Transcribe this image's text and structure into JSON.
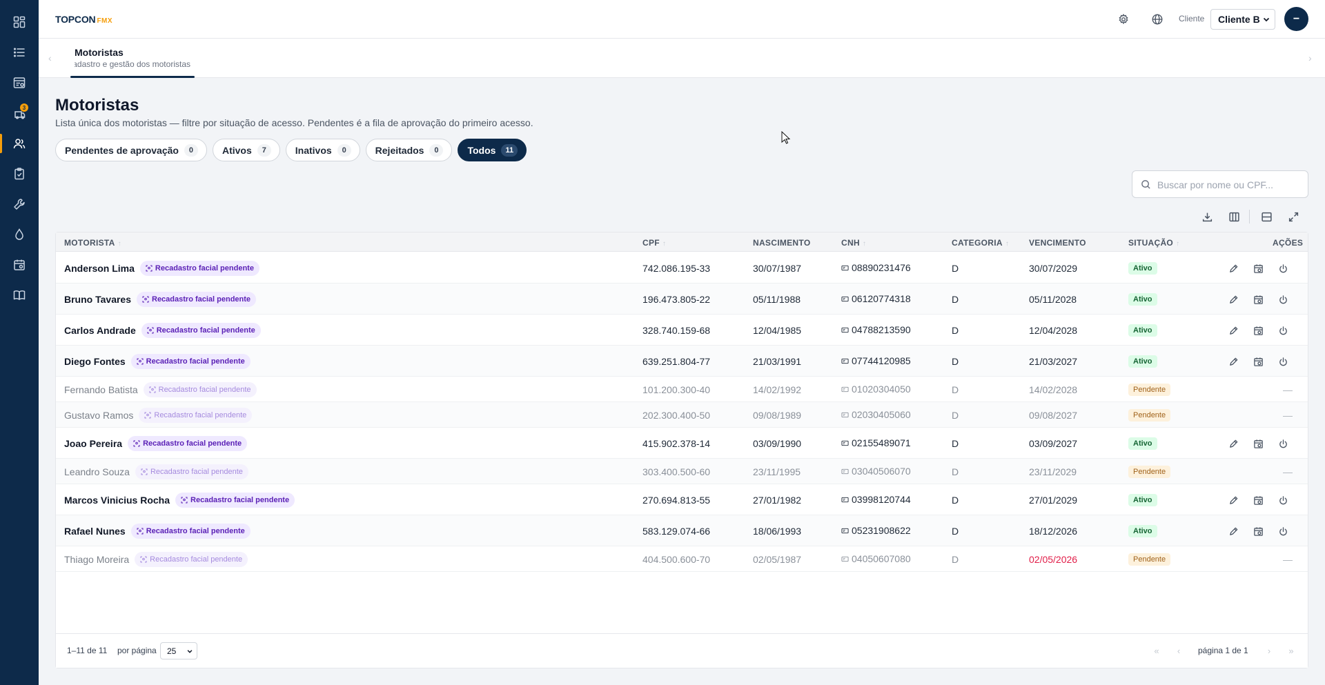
{
  "brand": {
    "name": "TOPCON",
    "suffix": "FMX"
  },
  "sidebar": {
    "items": [
      {
        "icon": "dashboard-grid-icon"
      },
      {
        "icon": "list-icon"
      },
      {
        "icon": "reports-icon"
      },
      {
        "icon": "vehicles-icon",
        "badge": "3"
      },
      {
        "icon": "users-icon",
        "active": true
      },
      {
        "icon": "checklist-icon"
      },
      {
        "icon": "wrench-icon"
      },
      {
        "icon": "fuel-drop-icon"
      },
      {
        "icon": "calendar-icon"
      },
      {
        "icon": "book-icon"
      }
    ]
  },
  "header": {
    "client_label": "Cliente",
    "client_value": "Cliente B",
    "avatar_initial": "−"
  },
  "tabstrip": {
    "tab_title": "Motoristas",
    "tab_subtitle": "Cadastro e gestão dos motoristas"
  },
  "page": {
    "title": "Motoristas",
    "description": "Lista única dos motoristas — filtre por situação de acesso. Pendentes é a fila de aprovação do primeiro acesso."
  },
  "filters": [
    {
      "label": "Pendentes de aprovação",
      "count": "0"
    },
    {
      "label": "Ativos",
      "count": "7"
    },
    {
      "label": "Inativos",
      "count": "0"
    },
    {
      "label": "Rejeitados",
      "count": "0"
    },
    {
      "label": "Todos",
      "count": "11",
      "active": true
    }
  ],
  "search": {
    "placeholder": "Buscar por nome ou CPF..."
  },
  "table": {
    "columns": {
      "motorista": "MOTORISTA",
      "cpf": "CPF",
      "nascimento": "NASCIMENTO",
      "cnh": "CNH",
      "categoria": "CATEGORIA",
      "vencimento": "VENCIMENTO",
      "situacao": "SITUAÇÃO",
      "acoes": "AÇÕES"
    },
    "facial_badge": "Recadastro facial pendente",
    "no_actions": "—",
    "rows": [
      {
        "name": "Anderson Lima",
        "cpf": "742.086.195-33",
        "nascimento": "30/07/1987",
        "cnh": "08890231476",
        "categoria": "D",
        "vencimento": "30/07/2029",
        "situacao": "Ativo"
      },
      {
        "name": "Bruno Tavares",
        "cpf": "196.473.805-22",
        "nascimento": "05/11/1988",
        "cnh": "06120774318",
        "categoria": "D",
        "vencimento": "05/11/2028",
        "situacao": "Ativo"
      },
      {
        "name": "Carlos Andrade",
        "cpf": "328.740.159-68",
        "nascimento": "12/04/1985",
        "cnh": "04788213590",
        "categoria": "D",
        "vencimento": "12/04/2028",
        "situacao": "Ativo"
      },
      {
        "name": "Diego Fontes",
        "cpf": "639.251.804-77",
        "nascimento": "21/03/1991",
        "cnh": "07744120985",
        "categoria": "D",
        "vencimento": "21/03/2027",
        "situacao": "Ativo"
      },
      {
        "name": "Fernando Batista",
        "cpf": "101.200.300-40",
        "nascimento": "14/02/1992",
        "cnh": "01020304050",
        "categoria": "D",
        "vencimento": "14/02/2028",
        "situacao": "Pendente"
      },
      {
        "name": "Gustavo Ramos",
        "cpf": "202.300.400-50",
        "nascimento": "09/08/1989",
        "cnh": "02030405060",
        "categoria": "D",
        "vencimento": "09/08/2027",
        "situacao": "Pendente"
      },
      {
        "name": "Joao Pereira",
        "cpf": "415.902.378-14",
        "nascimento": "03/09/1990",
        "cnh": "02155489071",
        "categoria": "D",
        "vencimento": "03/09/2027",
        "situacao": "Ativo"
      },
      {
        "name": "Leandro Souza",
        "cpf": "303.400.500-60",
        "nascimento": "23/11/1995",
        "cnh": "03040506070",
        "categoria": "D",
        "vencimento": "23/11/2029",
        "situacao": "Pendente"
      },
      {
        "name": "Marcos Vinicius Rocha",
        "cpf": "270.694.813-55",
        "nascimento": "27/01/1982",
        "cnh": "03998120744",
        "categoria": "D",
        "vencimento": "27/01/2029",
        "situacao": "Ativo"
      },
      {
        "name": "Rafael Nunes",
        "cpf": "583.129.074-66",
        "nascimento": "18/06/1993",
        "cnh": "05231908622",
        "categoria": "D",
        "vencimento": "18/12/2026",
        "situacao": "Ativo"
      },
      {
        "name": "Thiago Moreira",
        "cpf": "404.500.600-70",
        "nascimento": "02/05/1987",
        "cnh": "04050607080",
        "categoria": "D",
        "vencimento": "02/05/2026",
        "situacao": "Pendente",
        "vencimento_alert": true
      }
    ]
  },
  "footer": {
    "range": "1–11 de 11",
    "per_page_label": "por página",
    "per_page_value": "25",
    "page_info": "página 1 de 1"
  },
  "colors": {
    "sidebar": "#0d2a4a",
    "accent": "#f59e0b",
    "active_chip": "#0d2a4a",
    "status_ativo": "#166534",
    "status_pendente": "#a0621a",
    "facial_badge": "#5b21b6",
    "alert": "#e11d48"
  }
}
